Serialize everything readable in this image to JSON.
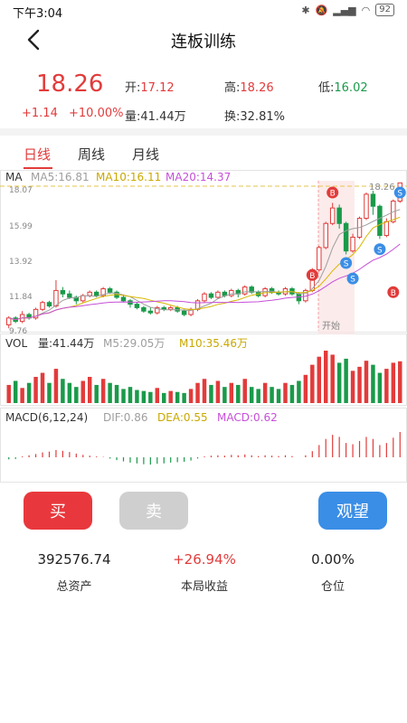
{
  "status": {
    "time": "下午3:04",
    "battery": "92"
  },
  "header": {
    "title": "连板训练"
  },
  "quote": {
    "price": "18.26",
    "change": "+1.14",
    "change_pct": "+10.00%",
    "open_label": "开:",
    "open": "17.12",
    "high_label": "高:",
    "high": "18.26",
    "low_label": "低:",
    "low": "16.02",
    "volume_label": "量:",
    "volume": "41.44万",
    "turnover_label": "换:",
    "turnover": "32.81%"
  },
  "tabs": [
    {
      "label": "日线"
    },
    {
      "label": "周线"
    },
    {
      "label": "月线"
    }
  ],
  "indicators": {
    "ma": {
      "label": "MA",
      "ma5": "MA5:16.81",
      "ma10": "MA10:16.11",
      "ma20": "MA20:14.37"
    },
    "vol": {
      "label": "VOL",
      "val": "量:41.44万",
      "m5": "M5:29.05万",
      "m10": "M10:35.46万"
    },
    "macd": {
      "label": "MACD(6,12,24)",
      "dif": "DIF:0.86",
      "dea": "DEA:0.55",
      "macd": "MACD:0.62"
    }
  },
  "price_axis": [
    "18.07",
    "15.99",
    "13.92",
    "11.84",
    "9.76"
  ],
  "last_price_tag": "18.26",
  "start_marker": "开始",
  "trade_markers": {
    "buy": "B",
    "sell": "S"
  },
  "colors": {
    "red": "#e23b3b",
    "green": "#1a9a4a",
    "ma5": "#9e9e9e",
    "ma10": "#d6b800",
    "ma20": "#c64fd8",
    "blue": "#3a8ee6"
  },
  "chart_data": {
    "type": "candlestick",
    "ylim": [
      9.76,
      18.07
    ],
    "candles": [
      [
        10.0,
        10.4,
        9.8,
        10.5
      ],
      [
        10.4,
        10.2,
        10.1,
        10.5
      ],
      [
        10.2,
        10.6,
        10.1,
        10.8
      ],
      [
        10.6,
        10.4,
        10.3,
        10.7
      ],
      [
        10.4,
        10.9,
        10.3,
        11.0
      ],
      [
        10.9,
        11.3,
        10.8,
        11.4
      ],
      [
        11.3,
        11.1,
        11.0,
        11.4
      ],
      [
        11.1,
        12.0,
        11.0,
        12.6
      ],
      [
        12.0,
        11.8,
        11.6,
        12.2
      ],
      [
        11.8,
        11.6,
        11.5,
        12.0
      ],
      [
        11.6,
        11.4,
        11.2,
        11.7
      ],
      [
        11.4,
        11.7,
        11.3,
        11.8
      ],
      [
        11.7,
        11.9,
        11.6,
        12.0
      ],
      [
        11.9,
        11.7,
        11.6,
        12.0
      ],
      [
        11.7,
        12.1,
        11.6,
        12.2
      ],
      [
        12.1,
        11.9,
        11.8,
        12.2
      ],
      [
        11.9,
        11.6,
        11.5,
        12.0
      ],
      [
        11.6,
        11.4,
        11.3,
        11.7
      ],
      [
        11.4,
        11.2,
        11.0,
        11.5
      ],
      [
        11.2,
        11.0,
        10.9,
        11.3
      ],
      [
        11.0,
        10.8,
        10.7,
        11.1
      ],
      [
        10.8,
        10.7,
        10.6,
        11.0
      ],
      [
        10.7,
        11.0,
        10.6,
        11.1
      ],
      [
        11.0,
        10.9,
        10.8,
        11.1
      ],
      [
        10.9,
        11.0,
        10.8,
        11.1
      ],
      [
        11.0,
        10.8,
        10.7,
        11.1
      ],
      [
        10.8,
        10.6,
        10.5,
        10.9
      ],
      [
        10.6,
        10.9,
        10.5,
        11.0
      ],
      [
        10.9,
        11.4,
        10.8,
        11.5
      ],
      [
        11.4,
        11.8,
        11.3,
        11.9
      ],
      [
        11.8,
        11.6,
        11.5,
        11.9
      ],
      [
        11.6,
        11.9,
        11.5,
        12.0
      ],
      [
        11.9,
        11.7,
        11.6,
        12.0
      ],
      [
        11.7,
        12.0,
        11.6,
        12.1
      ],
      [
        12.0,
        11.8,
        11.6,
        12.1
      ],
      [
        11.8,
        12.2,
        11.7,
        12.3
      ],
      [
        12.2,
        11.9,
        11.8,
        12.3
      ],
      [
        11.9,
        11.7,
        11.6,
        12.0
      ],
      [
        11.7,
        12.1,
        11.6,
        12.2
      ],
      [
        12.1,
        11.9,
        11.8,
        12.2
      ],
      [
        11.9,
        11.8,
        11.7,
        12.0
      ],
      [
        11.8,
        12.1,
        11.7,
        12.2
      ],
      [
        12.1,
        11.8,
        11.7,
        12.2
      ],
      [
        11.8,
        11.4,
        11.2,
        11.9
      ],
      [
        11.4,
        12.0,
        11.3,
        12.1
      ],
      [
        12.0,
        13.2,
        11.9,
        13.3
      ],
      [
        13.2,
        14.5,
        13.1,
        14.6
      ],
      [
        14.5,
        15.9,
        14.4,
        16.0
      ],
      [
        15.9,
        16.8,
        15.8,
        17.1
      ],
      [
        16.8,
        15.9,
        15.6,
        17.0
      ],
      [
        15.9,
        14.3,
        14.1,
        16.0
      ],
      [
        14.3,
        15.1,
        14.2,
        15.3
      ],
      [
        15.1,
        16.2,
        15.0,
        16.3
      ],
      [
        16.2,
        17.6,
        16.1,
        17.7
      ],
      [
        17.6,
        16.9,
        16.4,
        17.8
      ],
      [
        16.9,
        15.2,
        15.0,
        17.0
      ],
      [
        15.2,
        16.0,
        15.1,
        16.2
      ],
      [
        16.0,
        17.2,
        15.9,
        17.3
      ],
      [
        17.2,
        18.26,
        17.1,
        18.26
      ]
    ],
    "volume": [
      18,
      22,
      15,
      20,
      26,
      30,
      20,
      34,
      24,
      20,
      16,
      22,
      26,
      18,
      24,
      20,
      18,
      14,
      16,
      13,
      12,
      11,
      15,
      10,
      12,
      11,
      10,
      14,
      20,
      24,
      18,
      22,
      16,
      20,
      18,
      24,
      16,
      14,
      20,
      16,
      14,
      20,
      18,
      22,
      28,
      38,
      46,
      52,
      48,
      40,
      44,
      32,
      36,
      42,
      38,
      30,
      34,
      40,
      41.44
    ],
    "vol_m5": 29.05,
    "vol_m10": 35.46,
    "macd": [
      -0.05,
      -0.04,
      0.02,
      0.05,
      0.08,
      0.12,
      0.14,
      0.18,
      0.16,
      0.13,
      0.09,
      0.06,
      0.04,
      0.02,
      0.01,
      -0.03,
      -0.07,
      -0.1,
      -0.13,
      -0.15,
      -0.17,
      -0.18,
      -0.16,
      -0.15,
      -0.13,
      -0.12,
      -0.11,
      -0.08,
      -0.03,
      0.02,
      0.04,
      0.05,
      0.04,
      0.06,
      0.05,
      0.07,
      0.05,
      0.03,
      0.05,
      0.04,
      0.03,
      0.05,
      0.03,
      0.0,
      0.05,
      0.15,
      0.3,
      0.45,
      0.55,
      0.5,
      0.35,
      0.32,
      0.4,
      0.5,
      0.45,
      0.3,
      0.35,
      0.48,
      0.62
    ]
  },
  "actions": {
    "buy": "买",
    "sell": "卖",
    "watch": "观望"
  },
  "stats": [
    {
      "value": "392576.74",
      "label": "总资产"
    },
    {
      "value": "+26.94%",
      "label": "本局收益"
    },
    {
      "value": "0.00%",
      "label": "仓位"
    }
  ]
}
